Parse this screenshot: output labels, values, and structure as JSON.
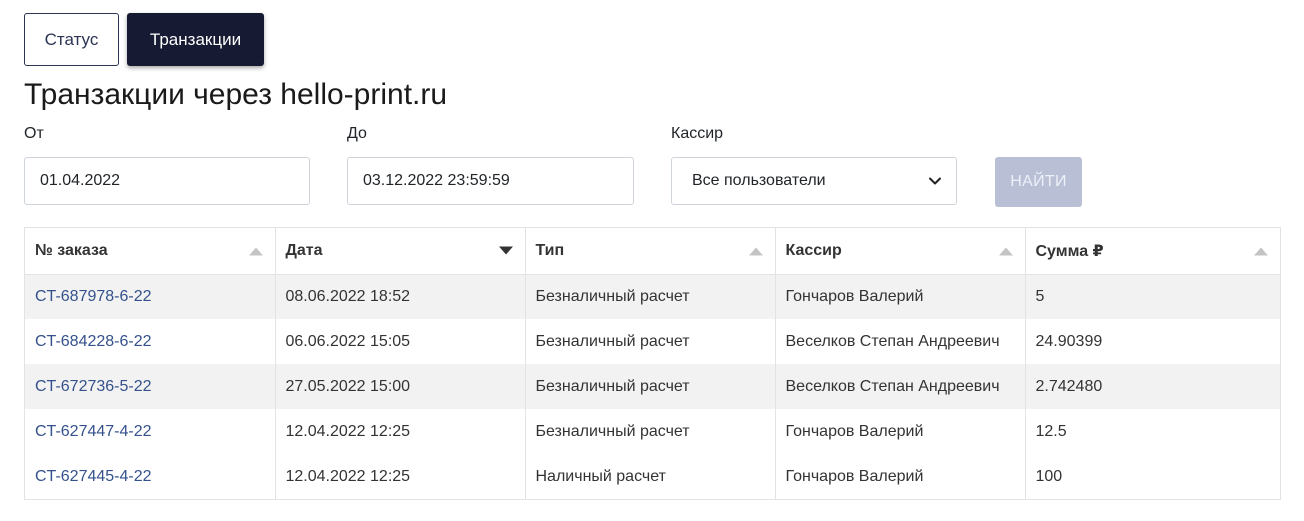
{
  "tabs": [
    {
      "label": "Статус",
      "active": false
    },
    {
      "label": "Транзакции",
      "active": true
    }
  ],
  "title": "Транзакции через hello-print.ru",
  "filters": {
    "from_label": "От",
    "from_value": "01.04.2022",
    "to_label": "До",
    "to_value": "03.12.2022 23:59:59",
    "cashier_label": "Кассир",
    "cashier_value": "Все пользователи",
    "find_label": "НАЙТИ"
  },
  "table": {
    "columns": [
      {
        "label": "№ заказа",
        "sort": "up-inactive"
      },
      {
        "label": "Дата",
        "sort": "down-active"
      },
      {
        "label": "Тип",
        "sort": "up-inactive"
      },
      {
        "label": "Кассир",
        "sort": "up-inactive"
      },
      {
        "label": "Сумма ₽",
        "sort": "up-inactive"
      }
    ],
    "rows": [
      {
        "order": "CT-687978-6-22",
        "date": "08.06.2022 18:52",
        "type": "Безналичный расчет",
        "cashier": "Гончаров Валерий",
        "sum": "5"
      },
      {
        "order": "CT-684228-6-22",
        "date": "06.06.2022 15:05",
        "type": "Безналичный расчет",
        "cashier": "Веселков Степан Андреевич",
        "sum": "24.90399"
      },
      {
        "order": "CT-672736-5-22",
        "date": "27.05.2022 15:00",
        "type": "Безналичный расчет",
        "cashier": "Веселков Степан Андреевич",
        "sum": "2.742480"
      },
      {
        "order": "CT-627447-4-22",
        "date": "12.04.2022 12:25",
        "type": "Безналичный расчет",
        "cashier": "Гончаров Валерий",
        "sum": "12.5"
      },
      {
        "order": "CT-627445-4-22",
        "date": "12.04.2022 12:25",
        "type": "Наличный расчет",
        "cashier": "Гончаров Валерий",
        "sum": "100"
      }
    ]
  },
  "colors": {
    "active_tab": "#161a33",
    "link": "#34518c",
    "find_button": "#b9c0d6",
    "row_stripe": "#f2f2f2"
  },
  "icons": {
    "sort_up": "sort-up-icon",
    "sort_down": "sort-down-icon",
    "dropdown": "chevron-down-icon"
  }
}
